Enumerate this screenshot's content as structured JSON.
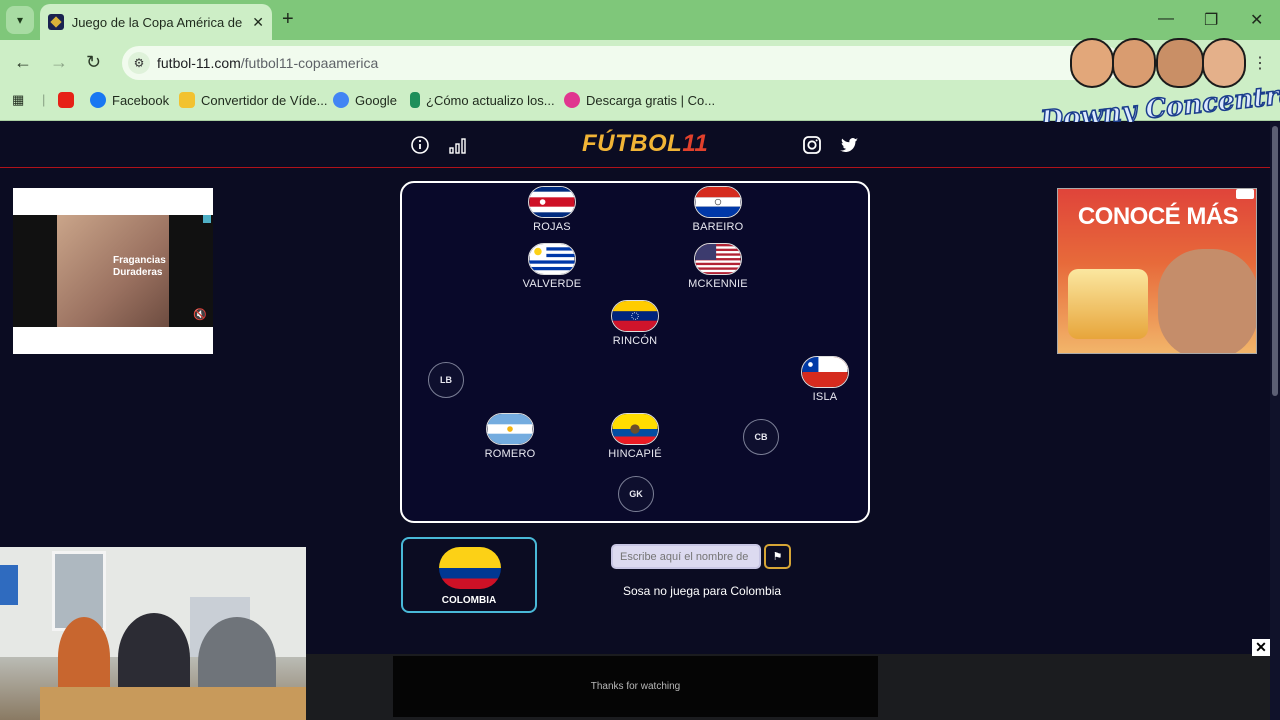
{
  "browser": {
    "tab_title": "Juego de la Copa América de F",
    "tab_close": "✕",
    "new_tab": "+",
    "url_host": "futbol-11.com",
    "url_path": "/futbol11-copaamerica",
    "window_controls": [
      "—",
      "❐",
      "✕"
    ],
    "bookmarks": [
      {
        "label": "",
        "icon": "youtube-icon",
        "color": "#e62117"
      },
      {
        "label": "Facebook",
        "icon": "facebook-icon",
        "color": "#1877f2"
      },
      {
        "label": "Convertidor de Víde...",
        "icon": "converter-icon",
        "color": "#f2c230"
      },
      {
        "label": "Google",
        "icon": "google-icon",
        "color": "#4285f4"
      },
      {
        "label": "¿Cómo actualizo los...",
        "icon": "update-icon",
        "color": "#1e8f5a"
      },
      {
        "label": "Descarga gratis | Co...",
        "icon": "download-icon",
        "color": "#e0368f"
      }
    ]
  },
  "watermark": {
    "text": "Downy Concentrao"
  },
  "site": {
    "brand": "FÚTBOL",
    "brand_number": "11",
    "accent_color": "#f1b436",
    "header_line_color": "#b0121a"
  },
  "ads": {
    "left_text": "Fragancias Duraderas",
    "right_headline": "CONOCÉ MÁS"
  },
  "pitch": {
    "players": [
      {
        "name": "ROJAS",
        "flag": "costa-rica"
      },
      {
        "name": "BAREIRO",
        "flag": "paraguay"
      },
      {
        "name": "VALVERDE",
        "flag": "uruguay"
      },
      {
        "name": "MCKENNIE",
        "flag": "usa"
      },
      {
        "name": "RINCÓN",
        "flag": "venezuela"
      },
      {
        "name": "ISLA",
        "flag": "chile"
      },
      {
        "name": "ROMERO",
        "flag": "argentina"
      },
      {
        "name": "HINCAPIÉ",
        "flag": "ecuador"
      }
    ],
    "empty_positions": [
      "LB",
      "CB",
      "GK"
    ]
  },
  "game": {
    "team_name": "COLOMBIA",
    "input_placeholder": "Escribe aquí el nombre de",
    "flag_button": "⚑",
    "feedback": "Sosa no juega para Colombia"
  },
  "overlay": {
    "thanks": "Thanks for watching",
    "close": "✕"
  }
}
